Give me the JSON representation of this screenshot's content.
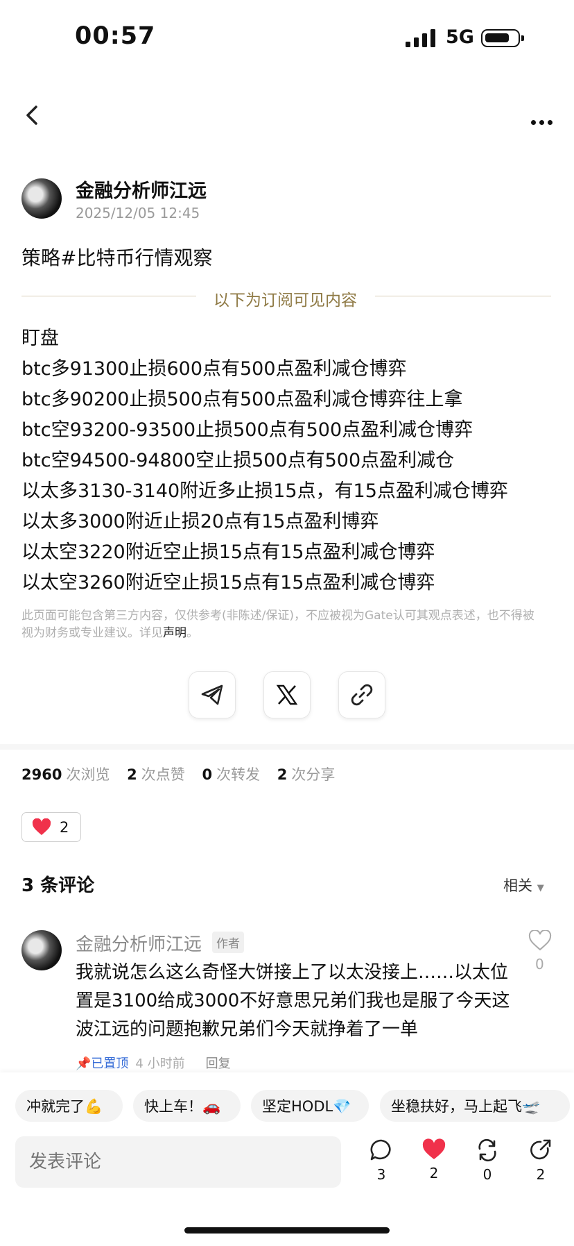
{
  "status_bar": {
    "time": "00:57",
    "network": "5G"
  },
  "post": {
    "author": "金融分析师江远",
    "date": "2025/12/05 12:45",
    "title": "策略#比特币行情观察",
    "subscriber_divider": "以下为订阅可见内容",
    "lines": [
      "盯盘",
      "btc多91300止损600点有500点盈利减仓博弈",
      "btc多90200止损500点有500点盈利减仓博弈往上拿",
      "btc空93200-93500止损500点有500点盈利减仓博弈",
      "btc空94500-94800空止损500点有500点盈利减仓",
      "以太多3130-3140附近多止损15点，有15点盈利减仓博弈",
      "以太多3000附近止损20点有15点盈利博弈",
      "以太空3220附近空止损15点有15点盈利减仓博弈",
      "以太空3260附近空止损15点有15点盈利减仓博弈"
    ],
    "disclaimer": "此页面可能包含第三方内容，仅供参考(非陈述/保证)，不应被视为Gate认可其观点表述，也不得被视为财务或专业建议。详见",
    "disclaimer_link": "声明",
    "disclaimer_end": "。"
  },
  "share_icons": [
    "telegram-icon",
    "x-icon",
    "link-icon"
  ],
  "stats": {
    "views": "2960",
    "views_label": "次浏览",
    "likes": "2",
    "likes_label": "次点赞",
    "reposts": "0",
    "reposts_label": "次转发",
    "shares": "2",
    "shares_label": "次分享"
  },
  "like_pill": {
    "count": "2"
  },
  "comments": {
    "header": "3 条评论",
    "sort": "相关",
    "items": [
      {
        "author": "金融分析师江远",
        "tag": "作者",
        "text": "我就说怎么这么奇怪大饼接上了以太没接上……以太位置是3100给成3000不好意思兄弟们我也是服了今天这波江远的问题抱歉兄弟们今天就挣着了一单",
        "likes": "0",
        "pinned": "已置顶",
        "time": "4 小时前",
        "reply": "回复"
      }
    ]
  },
  "quick_replies": [
    "冲就完了💪",
    "快上车！🚗",
    "坚定HODL💎",
    "坐稳扶好，马上起飞🛫"
  ],
  "compose": {
    "placeholder": "发表评论"
  },
  "actions": {
    "comments": "3",
    "likes": "2",
    "reposts": "0",
    "shares": "2"
  },
  "colors": {
    "like_red": "#f0314b",
    "gold": "#8f7a45",
    "link_blue": "#3a6fd8"
  }
}
